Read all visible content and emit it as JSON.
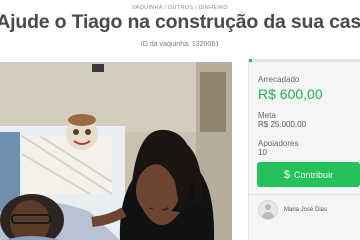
{
  "breadcrumb": "VAQUINHA / OUTROS / DINHEIRO",
  "title": "Ajude o Tiago na construção da sua casa",
  "vaquinha_id": "ID da vaquinha: 1320061",
  "campaign": {
    "raised_label": "Arrecadado",
    "raised_value": "R$ 600,00",
    "goal_label": "Meta",
    "goal_value": "R$ 25.000,00",
    "supporters_label": "Apoiadores",
    "supporters_value": "10",
    "progress_fraction": 0.024,
    "contribute_label": "Contribuir",
    "contribute_icon": "dollar-icon",
    "owner_name": "Maria José Dias"
  },
  "colors": {
    "accent": "#23c25a",
    "title": "#4a4a4a"
  }
}
